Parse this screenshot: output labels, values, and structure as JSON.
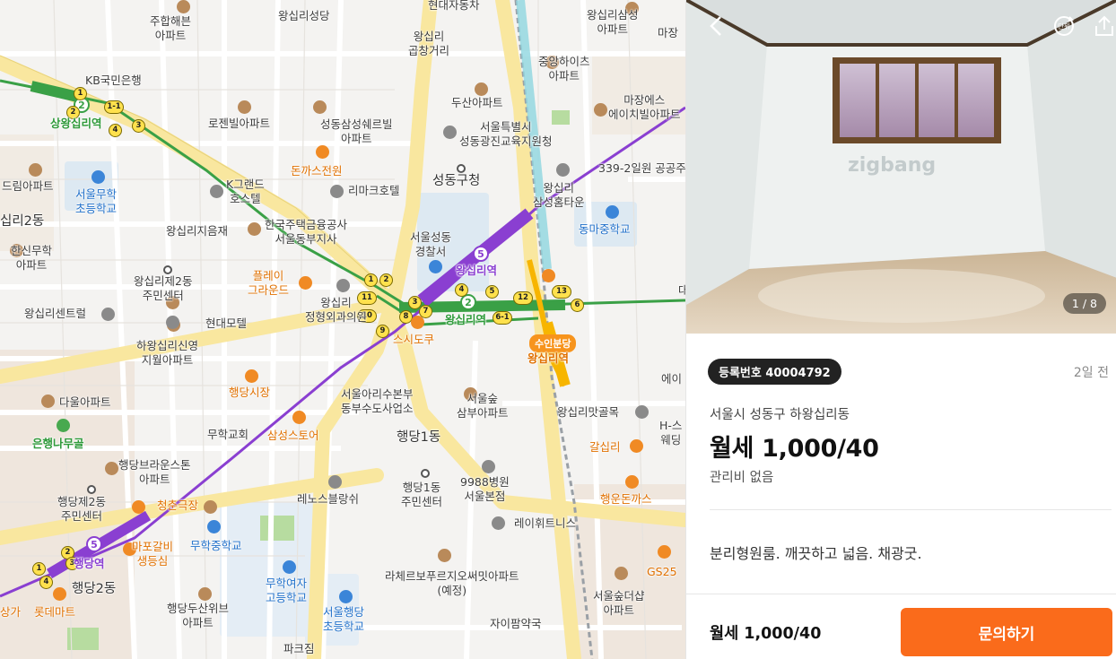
{
  "map": {
    "labels": {
      "jh": "주합해븐\n아파트",
      "wsl_church": "왕십리성당",
      "hyundai": "현대자동차",
      "wsl_samsung": "왕십리삼성\n아파트",
      "majang_top": "마장",
      "gopchang": "왕십리\n곱창거리",
      "kb": "KB국민은행",
      "jungang": "중앙하이츠\n아파트",
      "majang_es": "마장에스\n에이치빌아파트",
      "rosen": "로젠빌아파트",
      "seongdong_ss": "성동삼성쉐르빌\n아파트",
      "dusan": "두산아파트",
      "edu": "서울특별시\n성동광진교육지원청",
      "donkka": "돈까스전원",
      "rima": "리마크호텔",
      "k_grand": "K그랜드\n호스텔",
      "seoul_muhak": "서울무학\n초등학교",
      "dream": "드림아파트",
      "gu_office": "성동구청",
      "wsl_samsung_town": "왕십리\n삼성홈타운",
      "gonggong": "339-2일원 공공주",
      "khfc": "한국주택금융공사\n서울동부지사",
      "wsl2dong": "십리2동",
      "wsl_jieum": "왕십리지음재",
      "donga_mid": "동마중학교",
      "hanshin": "한신무학\n아파트",
      "police": "서울성동\n경찰서",
      "play": "플레이\n그라운드",
      "wsl2_center": "왕십리제2동\n주민센터",
      "wsl_ortho": "왕십리\n정형외과의원",
      "center_rel": "왕십리센트럴",
      "hyundai_motel": "현대모텔",
      "sushi": "스시도쿠",
      "hwang_shin": "하왕십리신영\n지월아파트",
      "subdivision": "수인분당",
      "alley": "왕십리맛골목",
      "haengdang_market": "행당시장",
      "arisu": "서울아리수본부\n동부수도사업소",
      "forest": "서울숲\n삼부아파트",
      "h_sports": "H-스\n웨딩",
      "eni": "에이",
      "dawool": "다울아파트",
      "muhak_church": "무학교회",
      "samsung_store": "삼성스토어",
      "haengdang1": "행당1동",
      "galsimni": "갈십리",
      "eunhaeng": "은행나무골",
      "brownstone": "행당브라운스톤\n아파트",
      "renos": "레노스블랑쉬",
      "hd1_center": "행당1동\n주민센터",
      "hosp9988": "9988병원\n서울본점",
      "haengun": "행운돈까스",
      "hd2_center": "행당제2동\n주민센터",
      "youth_theater": "청춘극장",
      "rayhwe": "레이휘트니스",
      "mapo": "마포갈비\n생등심",
      "muhak_mid": "무학중학교",
      "gs25": "GS25",
      "lachelle": "라체르보푸르지오써밋아파트\n(예정)",
      "muhak_girls": "무학여자\n고등학교",
      "haengdang2": "행당2동",
      "seoulforest_d": "서울숲더샵\n아파트",
      "lotte": "롯데마트",
      "haengdang_dusan": "행당두산위브\n아파트",
      "hd_elem": "서울행당\n초등학교",
      "jaipharm": "자이팜약국",
      "sangga": "상가",
      "parking": "파크짐",
      "sangwang_st": "상왕십리역",
      "wsl_st_purple": "왕십리역",
      "wsl_st_green": "왕십리역",
      "wsl_st_orange": "왕십리역",
      "haengdang_st": "행당역",
      "dae": "대"
    },
    "station_exits": [
      "1",
      "2",
      "3",
      "4",
      "1-1",
      "1",
      "2",
      "3",
      "4",
      "5",
      "6",
      "6-1",
      "7",
      "8",
      "9",
      "10",
      "11",
      "12",
      "13",
      "1",
      "2",
      "3",
      "4"
    ],
    "line_numbers": {
      "green": "2",
      "purple": "5"
    }
  },
  "panel": {
    "back_icon": "chevron-left-icon",
    "unit_label": "단위",
    "share_icon": "share-icon",
    "watermark": "zigbang",
    "photo_counter": "1 / 8",
    "reg_badge": "등록번호 40004792",
    "posted": "2일 전",
    "address": "서울시 성동구 하왕십리동",
    "price": "월세 1,000/40",
    "maintenance": "관리비 없음",
    "description": "분리형원룸. 깨끗하고 넓음. 채광굿.",
    "bottom_price": "월세 1,000/40",
    "inquiry_button": "문의하기"
  },
  "colors": {
    "line2": "#3aa046",
    "line5": "#8a3fd1",
    "suin_bundang": "#f7b500",
    "accent": "#fa6b1b"
  }
}
